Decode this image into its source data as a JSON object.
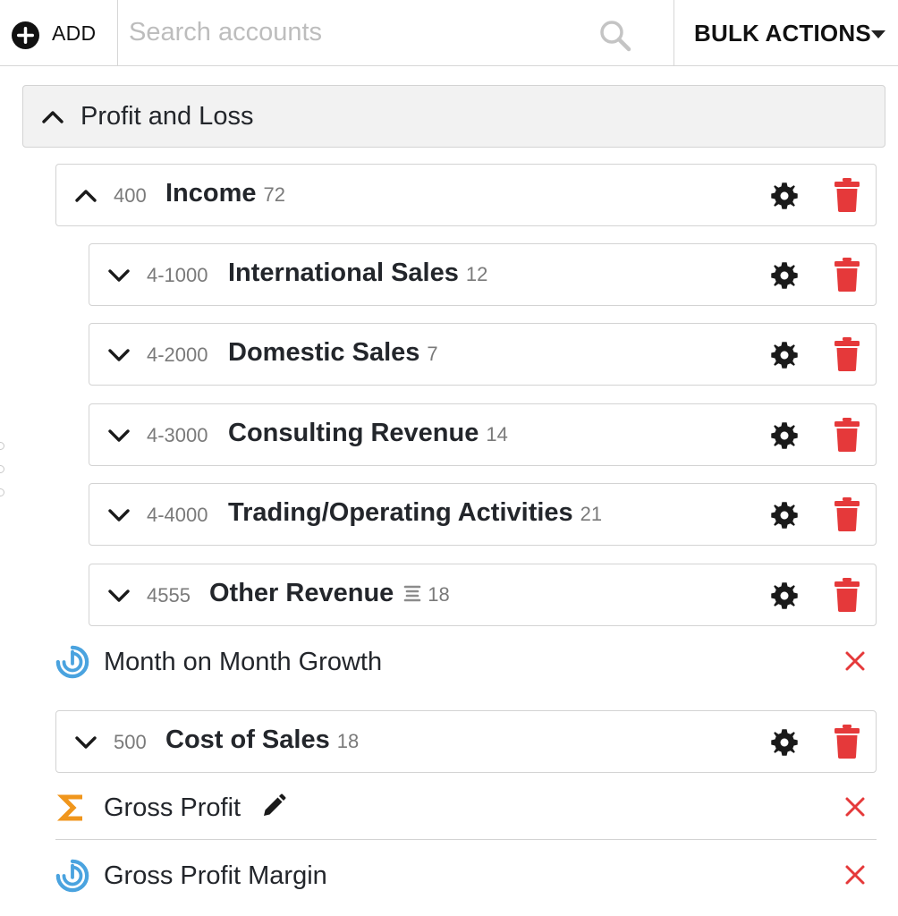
{
  "toolbar": {
    "add_label": "ADD",
    "search_placeholder": "Search accounts",
    "search_value": "",
    "bulk_label": "BULK ACTIONS"
  },
  "section": {
    "title": "Profit and Loss",
    "expanded": true
  },
  "accounts": [
    {
      "code": "400",
      "name": "Income",
      "count": "72",
      "expanded": true
    },
    {
      "code": "4-1000",
      "name": "International Sales",
      "count": "12",
      "expanded": false
    },
    {
      "code": "4-2000",
      "name": "Domestic Sales",
      "count": "7",
      "expanded": false
    },
    {
      "code": "4-3000",
      "name": "Consulting Revenue",
      "count": "14",
      "expanded": false
    },
    {
      "code": "4-4000",
      "name": "Trading/Operating Activities",
      "count": "21",
      "expanded": false
    },
    {
      "code": "4555",
      "name": "Other Revenue",
      "count": "18",
      "expanded": false,
      "icon": "document-lines-icon"
    },
    {
      "code": "500",
      "name": "Cost of Sales",
      "count": "18",
      "expanded": false
    }
  ],
  "formulas": [
    {
      "name": "Month on Month Growth",
      "icon": "growth-gauge-icon"
    },
    {
      "name": "Gross Profit",
      "icon": "sigma-icon",
      "editable": true
    },
    {
      "name": "Gross Profit Margin",
      "icon": "growth-gauge-icon"
    }
  ],
  "colors": {
    "danger": "#e5393a",
    "info": "#4aa3df",
    "sigma": "#f0961c",
    "text": "#23262b",
    "muted": "#7a7a7a",
    "border": "#d3d3d3",
    "header_bg": "#f2f2f2"
  }
}
